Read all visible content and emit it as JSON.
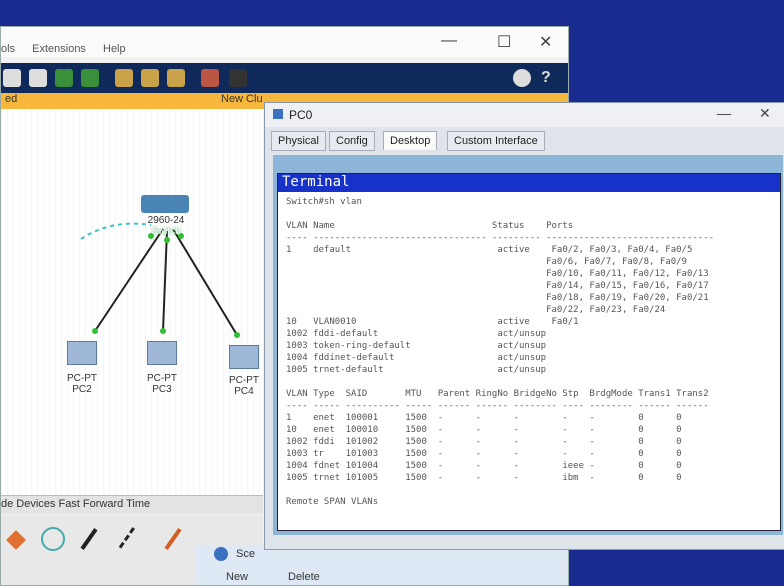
{
  "main": {
    "menu": [
      "ols",
      "Extensions",
      "Help"
    ],
    "tab_label": "New Clu",
    "tab_left": "ed",
    "status": "de   Devices   Fast Forward Time",
    "bottom": {
      "sce": "Sce",
      "new": "New",
      "delete": "Delete"
    },
    "devices": [
      {
        "name": "2960-24",
        "label": "Switch"
      },
      {
        "name": "PC-PT",
        "label": "PC2"
      },
      {
        "name": "PC-PT",
        "label": "PC3"
      },
      {
        "name": "PC-PT",
        "label": "PC4"
      }
    ]
  },
  "pc0": {
    "title": "PC0",
    "tabs": [
      "Physical",
      "Config",
      "Desktop",
      "Custom Interface"
    ],
    "active_tab": "Desktop",
    "terminal": {
      "title": "Terminal",
      "command": "Switch#sh vlan",
      "header1": "VLAN Name                             Status    Ports",
      "sep1": "---- -------------------------------- --------- -------------------------------",
      "vlans": [
        "1    default                           active    Fa0/2, Fa0/3, Fa0/4, Fa0/5",
        "                                                Fa0/6, Fa0/7, Fa0/8, Fa0/9",
        "                                                Fa0/10, Fa0/11, Fa0/12, Fa0/13",
        "                                                Fa0/14, Fa0/15, Fa0/16, Fa0/17",
        "                                                Fa0/18, Fa0/19, Fa0/20, Fa0/21",
        "                                                Fa0/22, Fa0/23, Fa0/24",
        "10   VLAN0010                          active    Fa0/1",
        "1002 fddi-default                      act/unsup",
        "1003 token-ring-default                act/unsup",
        "1004 fddinet-default                   act/unsup",
        "1005 trnet-default                     act/unsup"
      ],
      "header2": "VLAN Type  SAID       MTU   Parent RingNo BridgeNo Stp  BrdgMode Trans1 Trans2",
      "sep2": "---- ----- ---------- ----- ------ ------ -------- ---- -------- ------ ------",
      "rows": [
        "1    enet  100001     1500  -      -      -        -    -        0      0",
        "10   enet  100010     1500  -      -      -        -    -        0      0",
        "1002 fddi  101002     1500  -      -      -        -    -        0      0",
        "1003 tr    101003     1500  -      -      -        -    -        0      0",
        "1004 fdnet 101004     1500  -      -      -        ieee -        0      0",
        "1005 trnet 101005     1500  -      -      -        ibm  -        0      0"
      ],
      "footer": "Remote SPAN VLANs"
    }
  }
}
